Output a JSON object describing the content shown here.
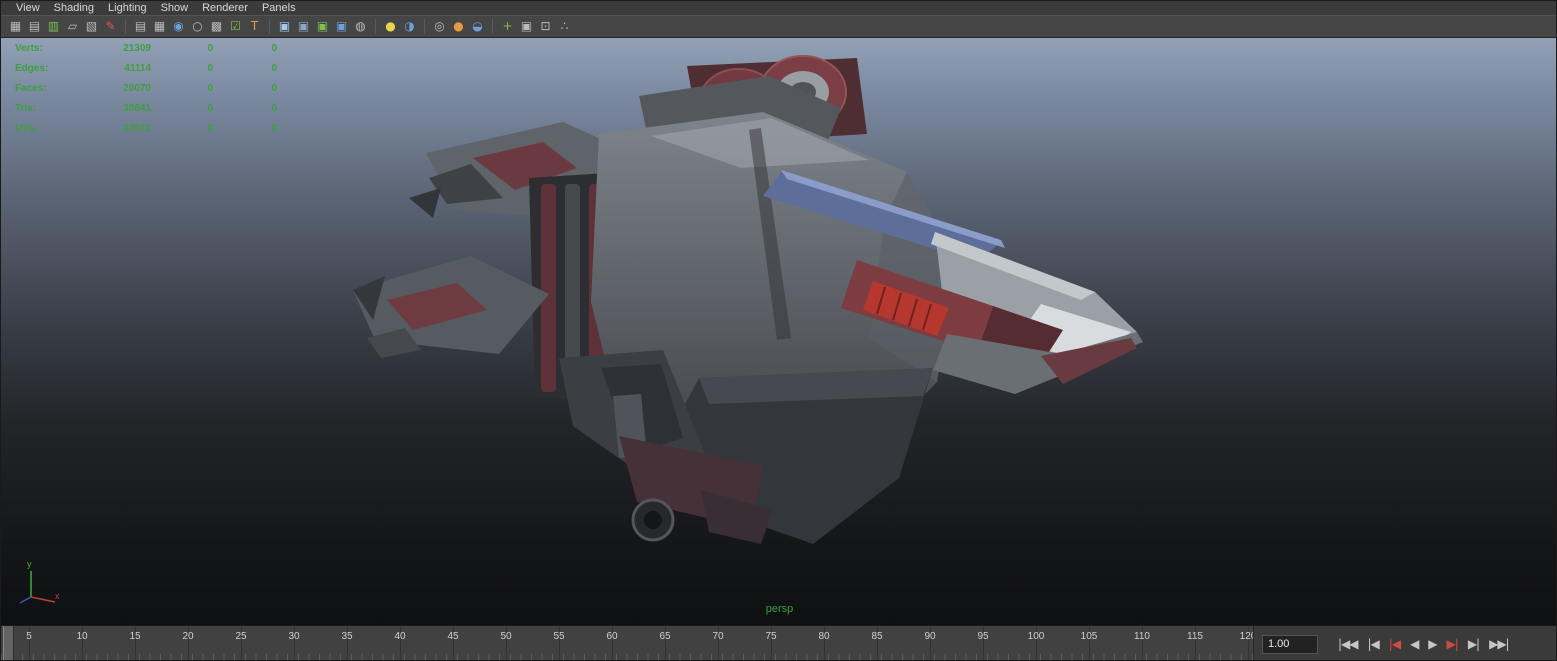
{
  "menu": {
    "items": [
      {
        "label": "View"
      },
      {
        "label": "Shading"
      },
      {
        "label": "Lighting"
      },
      {
        "label": "Show"
      },
      {
        "label": "Renderer"
      },
      {
        "label": "Panels"
      }
    ]
  },
  "toolbar": {
    "icons": [
      {
        "name": "camera-icon",
        "glyph": "▦"
      },
      {
        "name": "film-gate-icon",
        "glyph": "▤"
      },
      {
        "name": "chart-icon",
        "glyph": "▥"
      },
      {
        "name": "page-edit-icon",
        "glyph": "▱"
      },
      {
        "name": "marker-icon",
        "glyph": "▧"
      },
      {
        "name": "grease-pencil-icon",
        "glyph": "✎"
      },
      {
        "name": "film-strip-icon",
        "glyph": "▤"
      },
      {
        "name": "grid-icon",
        "glyph": "▦"
      },
      {
        "name": "shaded-sphere-icon",
        "glyph": "◉"
      },
      {
        "name": "wireframe-sphere-icon",
        "glyph": "○"
      },
      {
        "name": "checker-icon",
        "glyph": "▩"
      },
      {
        "name": "checkbox-icon",
        "glyph": "☑"
      },
      {
        "name": "texture-icon",
        "glyph": "T"
      },
      {
        "name": "cube-icon",
        "glyph": "▣"
      },
      {
        "name": "panel-cube-icon",
        "glyph": "▣"
      },
      {
        "name": "isolate-select-icon",
        "glyph": "▣"
      },
      {
        "name": "shaded-cube-icon",
        "glyph": "▣"
      },
      {
        "name": "checker-sphere-icon",
        "glyph": "◍"
      },
      {
        "name": "yellow-sphere-icon",
        "glyph": "●"
      },
      {
        "name": "gradient-sphere-icon",
        "glyph": "◑"
      },
      {
        "name": "specular-sphere-icon",
        "glyph": "◎"
      },
      {
        "name": "orange-sphere-icon",
        "glyph": "●"
      },
      {
        "name": "visor-icon",
        "glyph": "◒"
      },
      {
        "name": "snap-grid-icon",
        "glyph": "+"
      },
      {
        "name": "cube2-icon",
        "glyph": "▣"
      },
      {
        "name": "framed-cube-icon",
        "glyph": "⊡"
      },
      {
        "name": "share-nodes-icon",
        "glyph": "∴"
      }
    ]
  },
  "hud": {
    "rows": [
      {
        "label": "Verts:",
        "value": "21309",
        "col2": "0",
        "col3": "0"
      },
      {
        "label": "Edges:",
        "value": "41114",
        "col2": "0",
        "col3": "0"
      },
      {
        "label": "Faces:",
        "value": "20070",
        "col2": "0",
        "col3": "0"
      },
      {
        "label": "Tris:",
        "value": "38641",
        "col2": "0",
        "col3": "0"
      },
      {
        "label": "UVs:",
        "value": "37012",
        "col2": "0",
        "col3": "0"
      }
    ]
  },
  "viewport": {
    "camera_label": "persp",
    "axis": {
      "x": "x",
      "y": "y"
    }
  },
  "timeline": {
    "ticks": [
      "5",
      "10",
      "15",
      "20",
      "25",
      "30",
      "35",
      "40",
      "45",
      "50",
      "55",
      "60",
      "65",
      "70",
      "75",
      "80",
      "85",
      "90",
      "95",
      "100",
      "105",
      "110",
      "115",
      "120"
    ]
  },
  "playback": {
    "frame_field": "1.00",
    "buttons": [
      {
        "name": "go-to-start-button",
        "label": "|◀◀"
      },
      {
        "name": "step-back-frame-button",
        "label": "|◀"
      },
      {
        "name": "step-back-key-button",
        "label": "|◀"
      },
      {
        "name": "play-backwards-button",
        "label": "◀"
      },
      {
        "name": "play-forwards-button",
        "label": "▶"
      },
      {
        "name": "step-forward-key-button",
        "label": "▶|"
      },
      {
        "name": "step-forward-frame-button",
        "label": "▶|"
      },
      {
        "name": "go-to-end-button",
        "label": "▶▶|"
      }
    ]
  },
  "colors": {
    "hud_green": "#3f9e3f",
    "camera_label_green": "#3f9e3f",
    "axis_x_red": "#c23b3b",
    "axis_y_green": "#3fae3f",
    "key_button_red": "#d04a40",
    "viewport_gradient_top": "#93a1b6",
    "viewport_gradient_bottom": "#0f1011"
  }
}
